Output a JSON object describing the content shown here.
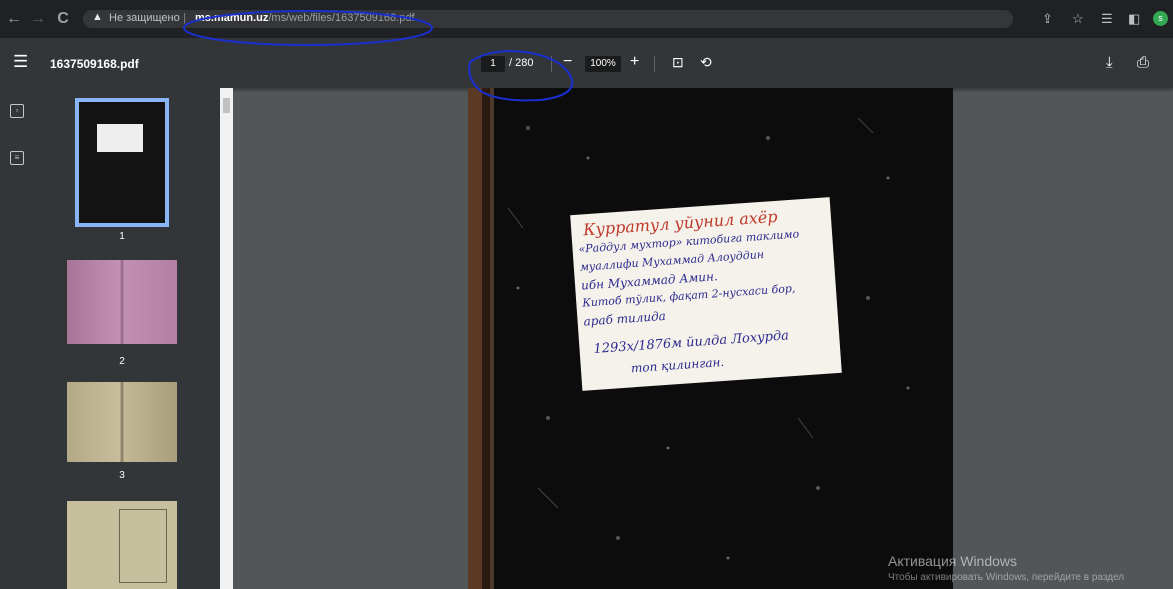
{
  "browser": {
    "security_label": "Не защищено",
    "url_domain": "ms.mamun.uz",
    "url_path": "/ms/web/files/1637509168.pdf",
    "avatar_letter": "s"
  },
  "viewer": {
    "file_name": "1637509168.pdf",
    "current_page": "1",
    "total_pages": "/ 280",
    "zoom": "100%"
  },
  "thumbnails": [
    {
      "label": "1"
    },
    {
      "label": "2"
    },
    {
      "label": "3"
    }
  ],
  "note": {
    "lines": [
      "Курратул уйунил ахёр",
      "«Раддул мухтор» китобига таклимо",
      "муаллифи Мухаммад Алоуддин",
      "ибн Мухаммад Амин.",
      "Китоб тўлик, фақат 2-нусхаси бор,",
      "араб тилида",
      "1293х/1876м йилда Лохурда",
      "топ қилинган."
    ]
  },
  "watermark": {
    "title": "Активация Windows",
    "subtitle": "Чтобы активировать Windows, перейдите в раздел"
  }
}
